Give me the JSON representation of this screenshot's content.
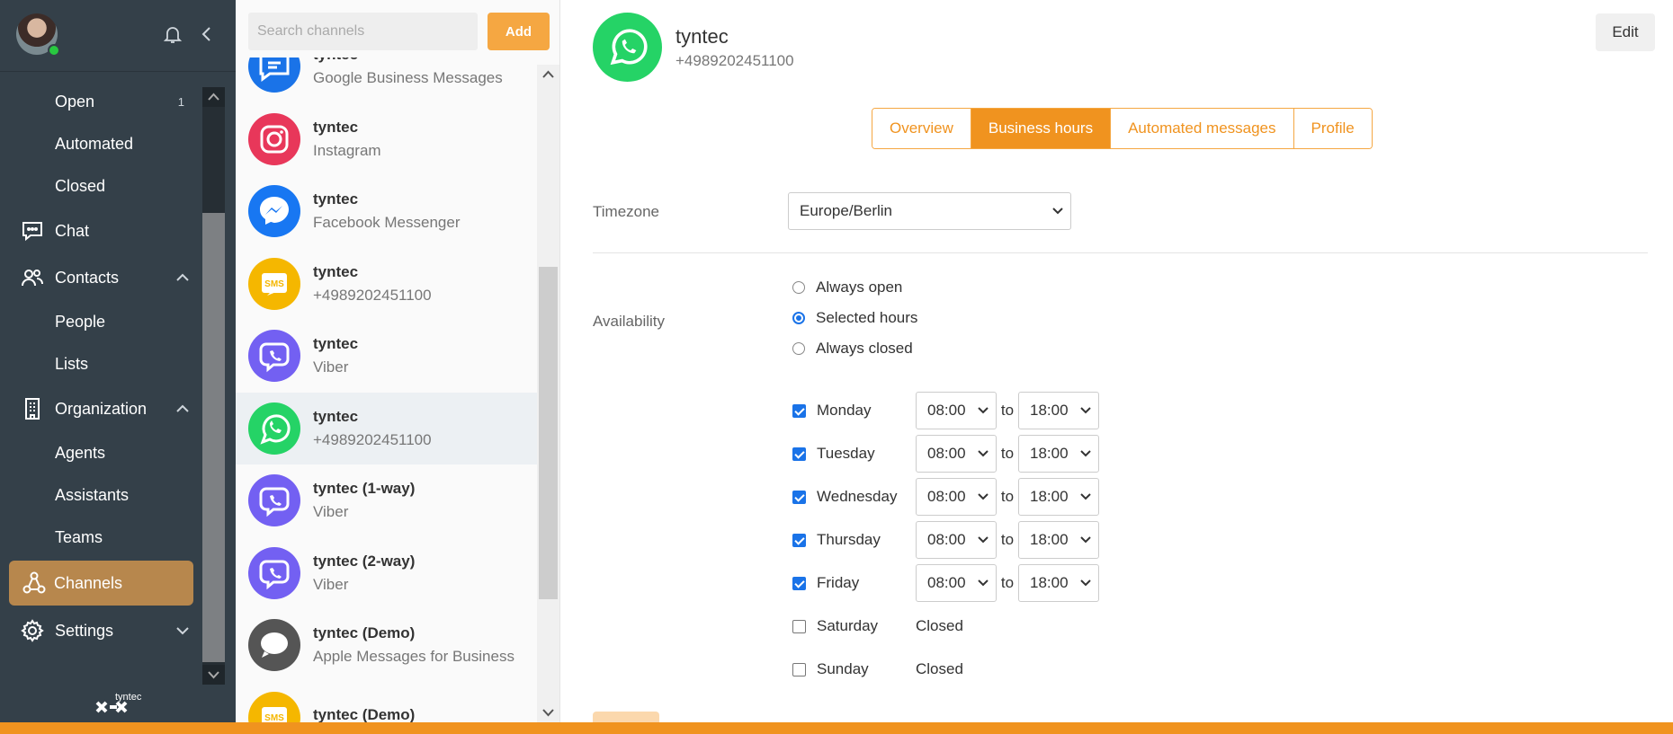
{
  "nav": {
    "items": [
      {
        "label": "Open",
        "count": "1"
      },
      {
        "label": "Automated"
      },
      {
        "label": "Closed"
      },
      {
        "label": "Chat",
        "icon": "chat-icon"
      },
      {
        "label": "Contacts",
        "icon": "contacts-icon"
      },
      {
        "label": "People"
      },
      {
        "label": "Lists"
      },
      {
        "label": "Organization",
        "icon": "building-icon"
      },
      {
        "label": "Agents"
      },
      {
        "label": "Assistants"
      },
      {
        "label": "Teams"
      },
      {
        "label": "Channels",
        "icon": "channels-icon"
      },
      {
        "label": "Settings",
        "icon": "gear-icon"
      }
    ],
    "logo_text": "tyntec"
  },
  "list": {
    "search_placeholder": "Search channels",
    "add_label": "Add",
    "channels": [
      {
        "name": "tyntec",
        "sub": "Google Business Messages",
        "icon": "google-business-messages-icon",
        "color": "#1a73e8"
      },
      {
        "name": "tyntec",
        "sub": "Instagram",
        "icon": "instagram-icon",
        "color": "#e8375a"
      },
      {
        "name": "tyntec",
        "sub": "Facebook Messenger",
        "icon": "messenger-icon",
        "color": "#1877f2"
      },
      {
        "name": "tyntec",
        "sub": "+4989202451100",
        "icon": "sms-icon",
        "color": "#f5b700"
      },
      {
        "name": "tyntec",
        "sub": "Viber",
        "icon": "viber-icon",
        "color": "#7360f2"
      },
      {
        "name": "tyntec",
        "sub": "+4989202451100",
        "icon": "whatsapp-icon",
        "color": "#25d366"
      },
      {
        "name": "tyntec (1-way)",
        "sub": "Viber",
        "icon": "viber-icon",
        "color": "#7360f2"
      },
      {
        "name": "tyntec (2-way)",
        "sub": "Viber",
        "icon": "viber-icon",
        "color": "#7360f2"
      },
      {
        "name": "tyntec (Demo)",
        "sub": "Apple Messages for Business",
        "icon": "apple-messages-icon",
        "color": "#555555"
      },
      {
        "name": "tyntec (Demo)",
        "sub": "",
        "icon": "sms-icon",
        "color": "#f5b700"
      }
    ]
  },
  "main": {
    "name": "tyntec",
    "number": "+4989202451100",
    "edit_label": "Edit",
    "tabs": [
      "Overview",
      "Business hours",
      "Automated messages",
      "Profile"
    ],
    "active_tab": "Business hours",
    "timezone_label": "Timezone",
    "timezone_value": "Europe/Berlin",
    "availability_label": "Availability",
    "availability_options": [
      "Always open",
      "Selected hours",
      "Always closed"
    ],
    "availability_selected": "Selected hours",
    "to_label": "to",
    "days": [
      {
        "day": "Monday",
        "checked": true,
        "from": "08:00",
        "to": "18:00"
      },
      {
        "day": "Tuesday",
        "checked": true,
        "from": "08:00",
        "to": "18:00"
      },
      {
        "day": "Wednesday",
        "checked": true,
        "from": "08:00",
        "to": "18:00"
      },
      {
        "day": "Thursday",
        "checked": true,
        "from": "08:00",
        "to": "18:00"
      },
      {
        "day": "Friday",
        "checked": true,
        "from": "08:00",
        "to": "18:00"
      },
      {
        "day": "Saturday",
        "checked": false,
        "status": "Closed"
      },
      {
        "day": "Sunday",
        "checked": false,
        "status": "Closed"
      }
    ]
  },
  "colors": {
    "accent": "#f0931f",
    "nav_bg": "#344049",
    "active_nav": "#b7874d",
    "checkbox": "#1a73e8"
  }
}
